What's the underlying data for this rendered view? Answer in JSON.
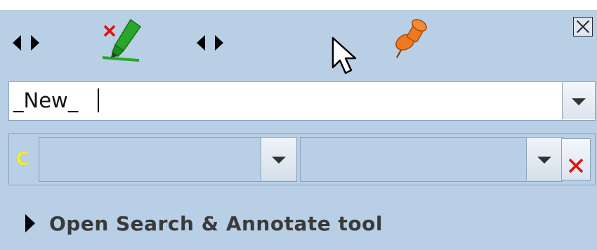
{
  "entry": {
    "value": "_New_"
  },
  "filter": {
    "case_glyph": "C",
    "field_a": "",
    "field_b": ""
  },
  "search": {
    "link_label": "Open Search & Annotate tool"
  },
  "icons": {
    "close": "close-icon",
    "arrows": "left-right-arrows-icon",
    "delete_annotation": "highlighter-delete-icon",
    "pin": "pushpin-icon",
    "cursor": "mouse-pointer-icon",
    "dropdown": "chevron-down-icon",
    "clear": "red-x-icon",
    "expand": "triangle-right-icon"
  },
  "colors": {
    "panel": "#b8cfe5",
    "pin": "#f07820",
    "highlighter": "#2aa62a",
    "clear_x": "#e01010",
    "case_glyph": "#f0ea3a"
  }
}
